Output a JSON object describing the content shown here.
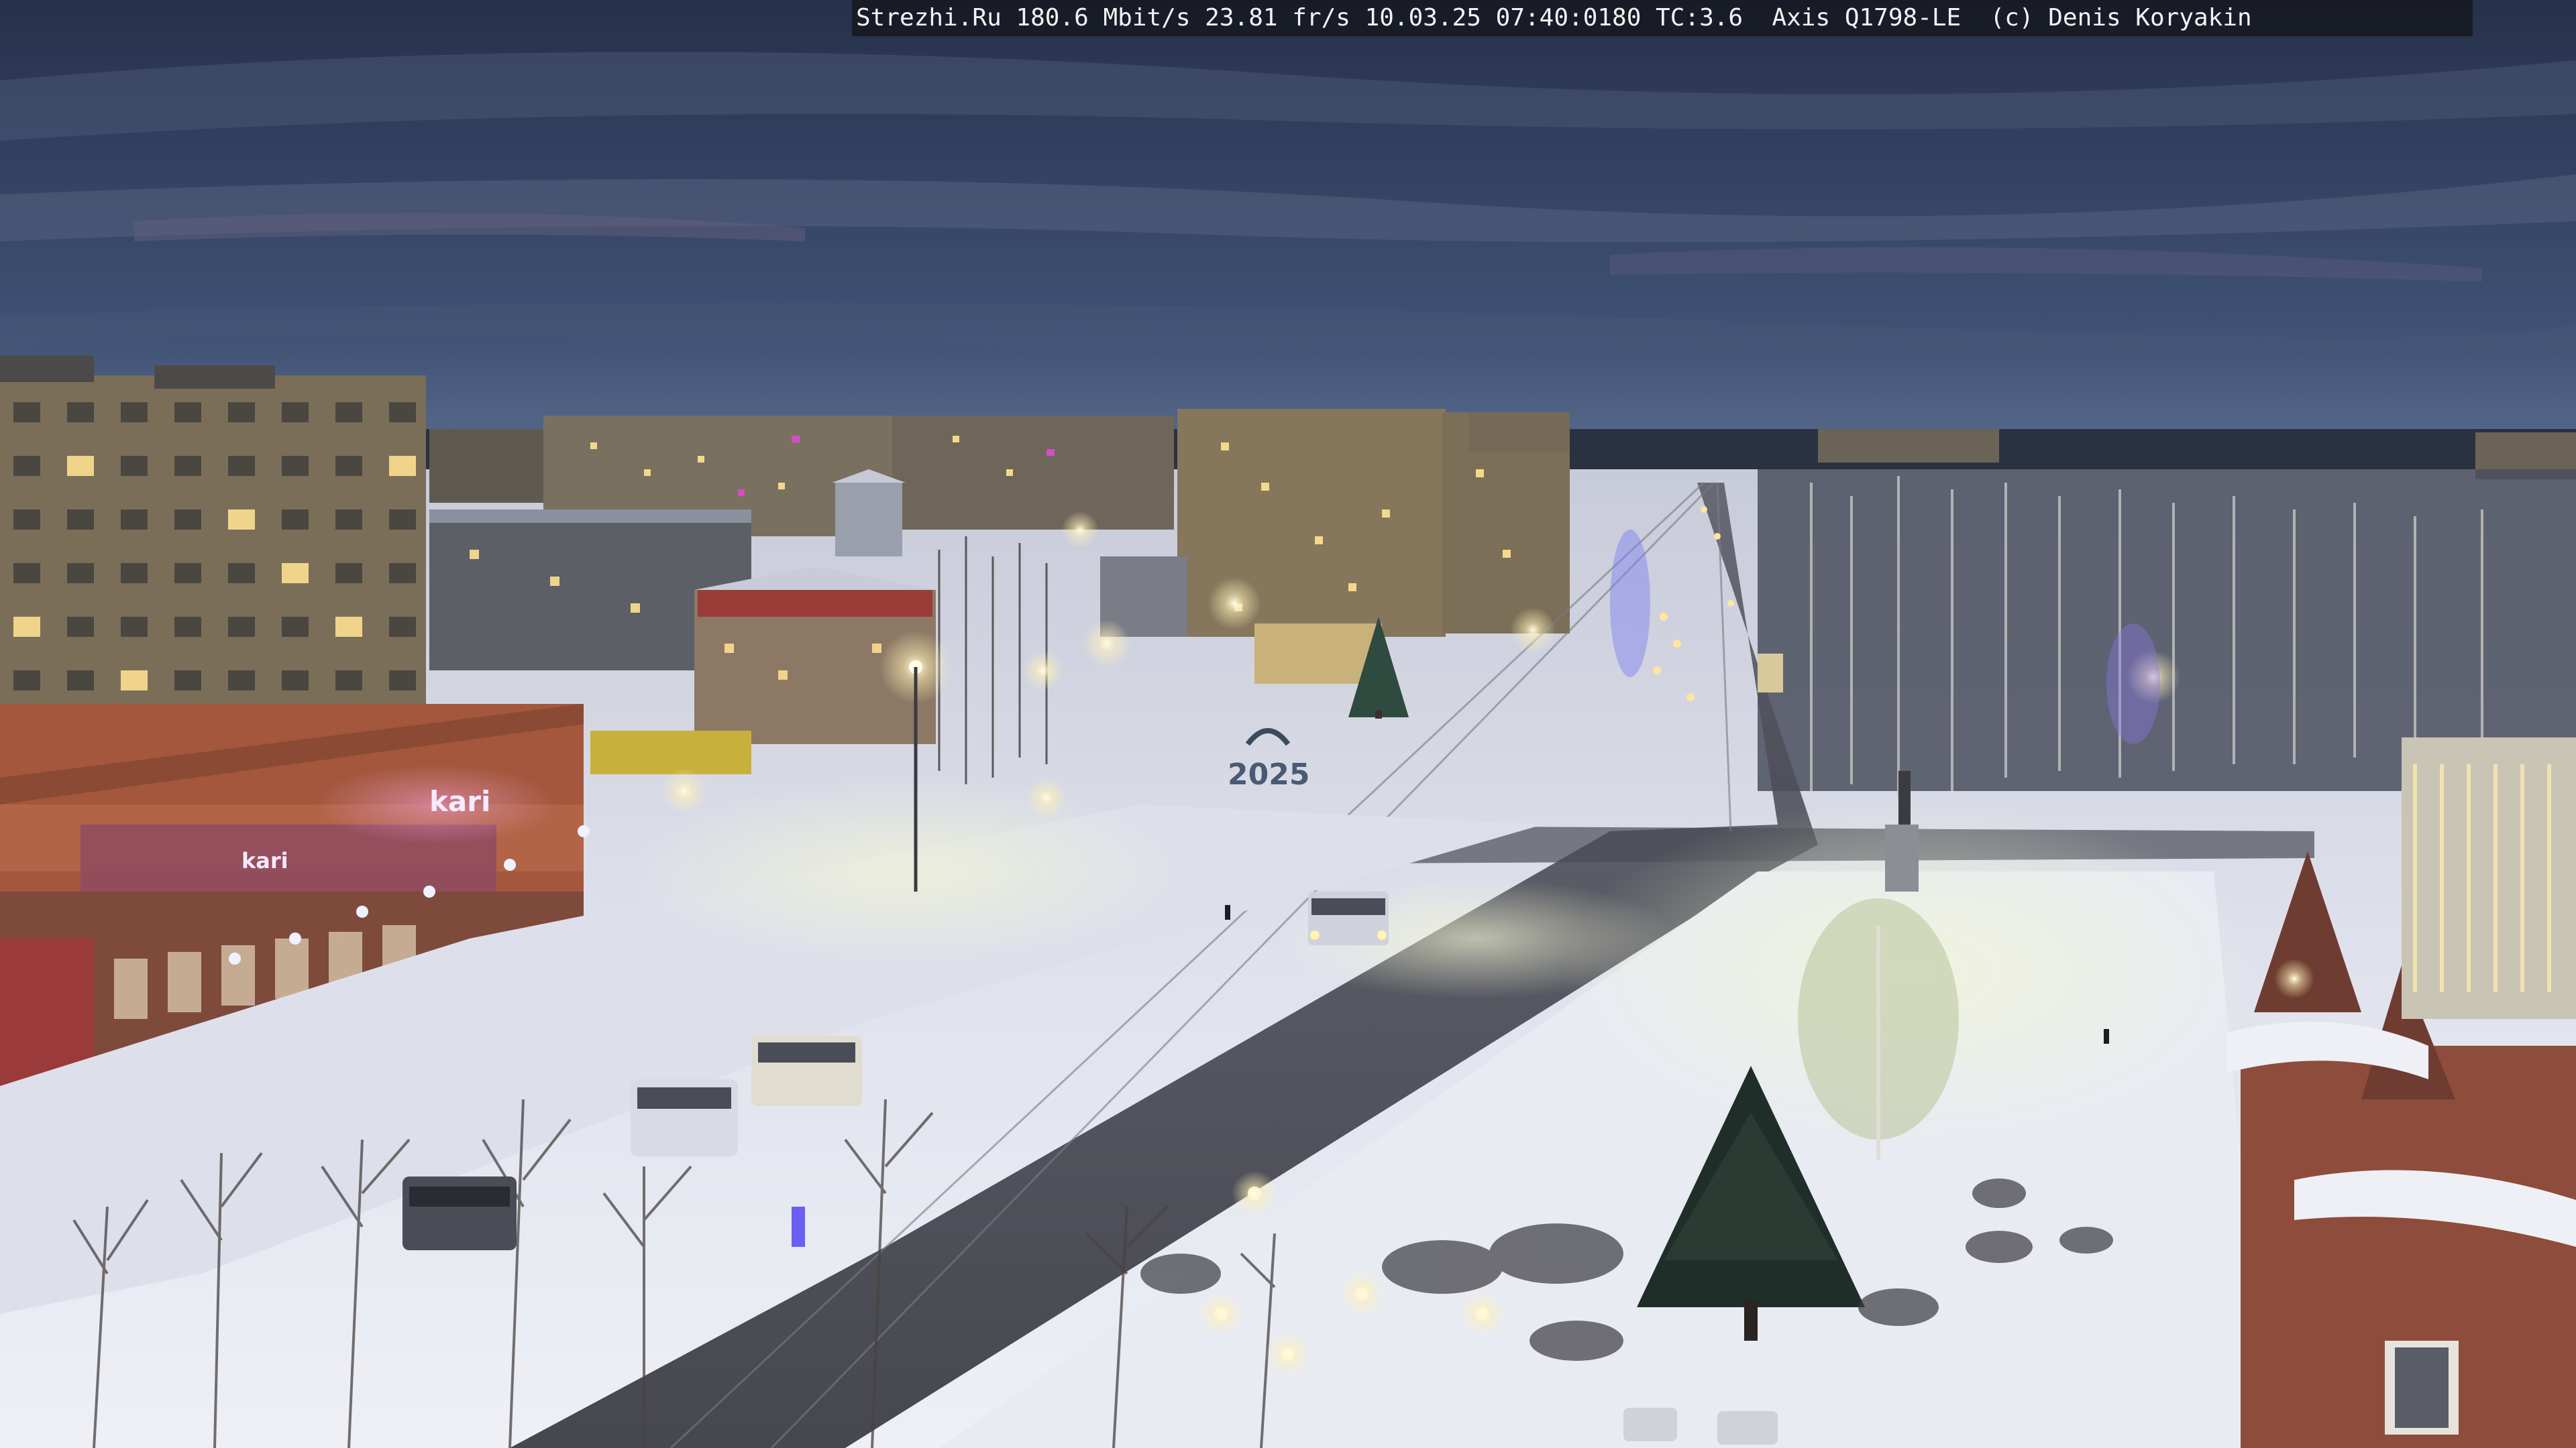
{
  "camera": {
    "overlay_text": "Strezhi.Ru 180.6 Mbit/s 23.81 fr/s 10.03.25 07:40:0180 TC:3.6  Axis Q1798-LE  (c) Denis Koryakin"
  },
  "scene": {
    "description_free": true,
    "signs": {
      "store_sign": "kari",
      "store_sign_2": "kari",
      "monument_year": "2025"
    },
    "colors": {
      "sky_top": "#28324a",
      "sky_mid": "#3a4866",
      "sky_horizon": "#4f6584",
      "snow": "#e6e8f0",
      "snow_shadow": "#b9bfd2",
      "road": "#3d3e46",
      "building_beige": "#8a7c62",
      "building_brick": "#a5563a",
      "lamp_glow": "#fff3c4"
    }
  }
}
